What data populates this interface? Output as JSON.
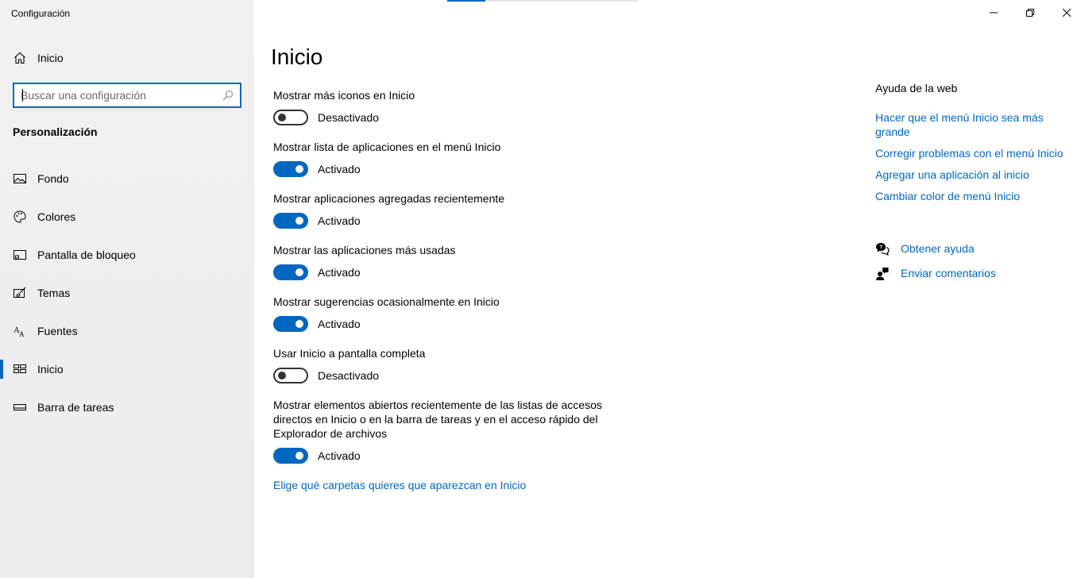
{
  "app_title": "Configuración",
  "window_controls": {
    "minimize_glyph": "—",
    "restore_glyph": "restore",
    "close_glyph": "✕"
  },
  "sidebar": {
    "home_label": "Inicio",
    "search": {
      "placeholder": "Buscar una configuración",
      "value": ""
    },
    "section_heading": "Personalización",
    "items": [
      {
        "label": "Fondo",
        "icon": "picture-icon",
        "selected": false
      },
      {
        "label": "Colores",
        "icon": "palette-icon",
        "selected": false
      },
      {
        "label": "Pantalla de bloqueo",
        "icon": "lock-screen-icon",
        "selected": false
      },
      {
        "label": "Temas",
        "icon": "brush-icon",
        "selected": false
      },
      {
        "label": "Fuentes",
        "icon": "font-icon",
        "selected": false
      },
      {
        "label": "Inicio",
        "icon": "start-layout-icon",
        "selected": true
      },
      {
        "label": "Barra de tareas",
        "icon": "taskbar-icon",
        "selected": false
      }
    ]
  },
  "main": {
    "title": "Inicio",
    "settings": [
      {
        "title": "Mostrar más iconos en Inicio",
        "state_label": "Desactivado",
        "on": false
      },
      {
        "title": "Mostrar lista de aplicaciones en el menú Inicio",
        "state_label": "Activado",
        "on": true
      },
      {
        "title": "Mostrar aplicaciones agregadas recientemente",
        "state_label": "Activado",
        "on": true
      },
      {
        "title": "Mostrar las aplicaciones más usadas",
        "state_label": "Activado",
        "on": true
      },
      {
        "title": "Mostrar sugerencias ocasionalmente en Inicio",
        "state_label": "Activado",
        "on": true
      },
      {
        "title": "Usar Inicio a pantalla completa",
        "state_label": "Desactivado",
        "on": false
      },
      {
        "title": "Mostrar elementos abiertos recientemente de las listas de accesos directos en Inicio o en la barra de tareas y en el acceso rápido del Explorador de archivos",
        "state_label": "Activado",
        "on": true
      }
    ],
    "folders_link": "Elige qué carpetas quieres que aparezcan en Inicio"
  },
  "help": {
    "heading": "Ayuda de la web",
    "links": [
      "Hacer que el menú Inicio sea más grande",
      "Corregir problemas con el menú Inicio",
      "Agregar una aplicación al inicio",
      "Cambiar color de menú Inicio"
    ],
    "get_help": "Obtener ayuda",
    "feedback": "Enviar comentarios"
  },
  "colors": {
    "accent": "#0067c0",
    "sidebar_bg": "#f0f0f0"
  }
}
